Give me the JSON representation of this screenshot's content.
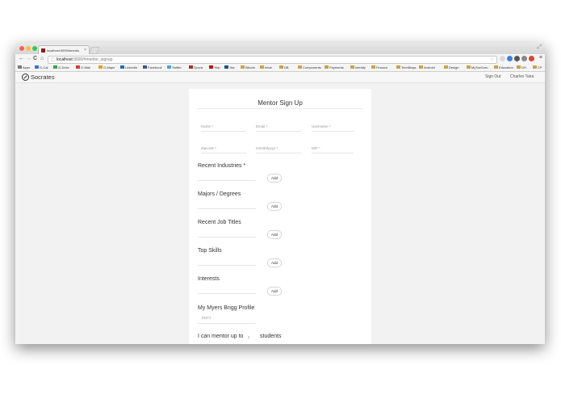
{
  "browser": {
    "tab_title": "localhost:9000/#mento",
    "tab_close": "×",
    "address_host": "localhost",
    "address_path": ":9000/#mentor_signup",
    "nav": {
      "back": "←",
      "forward": "→",
      "reload": "C",
      "home": "⌂"
    },
    "star": "☆",
    "menu": "≡",
    "resize": "⤢"
  },
  "bookmarks": [
    {
      "label": "Apps",
      "color": "#7a7a7a"
    },
    {
      "label": "G-Cal",
      "color": "#3b6fd6"
    },
    {
      "label": "G-Drive",
      "color": "#2ea84f"
    },
    {
      "label": "G-Mail",
      "color": "#d63b3b"
    },
    {
      "label": "G-Maps",
      "color": "#e0a020"
    },
    {
      "label": "LinkedIn",
      "color": "#1e6fb5"
    },
    {
      "label": "Facebook",
      "color": "#3b5998"
    },
    {
      "label": "Twitter",
      "color": "#4aa3df"
    },
    {
      "label": "Quora",
      "color": "#b92b27"
    },
    {
      "label": "Yelp",
      "color": "#c41200"
    },
    {
      "label": "Jira",
      "color": "#205081"
    },
    {
      "label": "Bitcoin",
      "color": "#c9a34a"
    },
    {
      "label": "Intuit",
      "color": "#c9a34a"
    },
    {
      "label": "DB",
      "color": "#c9a34a"
    },
    {
      "label": "Components",
      "color": "#c9a34a"
    },
    {
      "label": "Payments",
      "color": "#c9a34a"
    },
    {
      "label": "Identity",
      "color": "#c9a34a"
    },
    {
      "label": "Finance",
      "color": "#c9a34a"
    },
    {
      "label": "TechBlogs",
      "color": "#c9a34a"
    },
    {
      "label": "Android",
      "color": "#c9a34a"
    },
    {
      "label": "Design",
      "color": "#c9a34a"
    },
    {
      "label": "MyTaxGuru",
      "color": "#c9a34a"
    },
    {
      "label": "Education",
      "color": "#c9a34a"
    },
    {
      "label": "DH",
      "color": "#c9a34a"
    },
    {
      "label": "CP",
      "color": "#c9a34a"
    }
  ],
  "app": {
    "name": "Socrates",
    "sign_out": "Sign Out",
    "user_name": "Charles Taira"
  },
  "form": {
    "title": "Mentor Sign Up",
    "placeholders": {
      "name": "Name *",
      "email": "Email *",
      "username": "Username *",
      "zipcode": "Zipcode *",
      "birthdate": "mm/dd/yyyy *",
      "gender": "M/F *"
    },
    "sections": [
      {
        "label": "Recent Industries *",
        "add": "Add"
      },
      {
        "label": "Majors / Degrees",
        "add": "Add"
      },
      {
        "label": "Recent Job Titles",
        "add": "Add"
      },
      {
        "label": "Top Skills",
        "add": "Add"
      },
      {
        "label": "Interests",
        "add": "Add"
      }
    ],
    "myers_briggs_label": "My Myers Brigg Profile",
    "myers_briggs_value": "ENTJ",
    "mentor_capacity_prefix": "I can mentor up to",
    "mentor_capacity_value": "2",
    "mentor_capacity_suffix": "students"
  }
}
